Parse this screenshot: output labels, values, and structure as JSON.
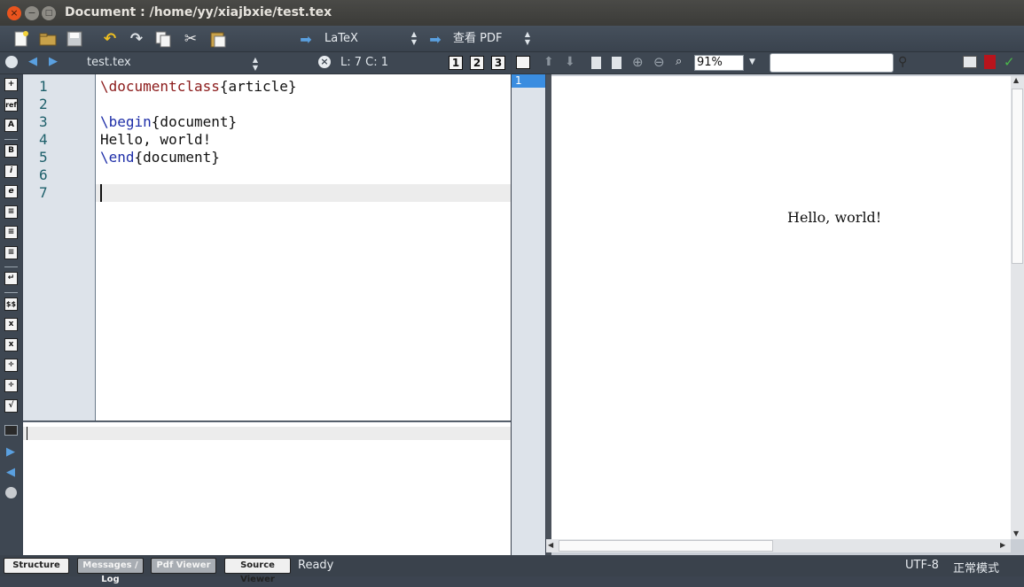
{
  "window": {
    "title": "Document : /home/yy/xiajbxie/test.tex",
    "controls": {
      "close": "×",
      "minimize": "−",
      "maximize": "□"
    }
  },
  "toolbar": {
    "icons": [
      "new-file-icon",
      "open-icon",
      "save-icon",
      "undo-icon",
      "redo-icon",
      "copy-icon",
      "cut-icon",
      "paste-icon"
    ],
    "build_combo": "LaTeX",
    "view_combo": "查看 PDF",
    "accent": "#5aa0e0"
  },
  "editor_header": {
    "file_name": "test.tex",
    "cursor_position": "L: 7 C: 1",
    "view_buttons": [
      "1",
      "2",
      "3"
    ]
  },
  "pdf_toolbar": {
    "zoom": "91%",
    "search_placeholder": ""
  },
  "sidebar_icons": [
    "+",
    "ref",
    "A",
    "B",
    "i",
    "e",
    "≡",
    "≡",
    "≡",
    "↵",
    "$$",
    "x",
    "x",
    "÷",
    "÷",
    "√"
  ],
  "editor": {
    "line_numbers": [
      "1",
      "2",
      "3",
      "4",
      "5",
      "6",
      "7"
    ],
    "lines": [
      {
        "cmd": "\\documentclass",
        "arg": "{article}",
        "style": "red"
      },
      {
        "cmd": "",
        "arg": "",
        "style": "plain"
      },
      {
        "cmd": "\\begin",
        "arg": "{document}",
        "style": "blue"
      },
      {
        "cmd": "",
        "arg": "Hello, world!",
        "style": "plain"
      },
      {
        "cmd": "\\end",
        "arg": "{document}",
        "style": "blue"
      },
      {
        "cmd": "",
        "arg": "",
        "style": "plain"
      },
      {
        "cmd": "",
        "arg": "",
        "style": "plain"
      }
    ]
  },
  "pdf": {
    "page_number": "1",
    "content": "Hello, world!"
  },
  "statusbar": {
    "buttons": [
      "Structure",
      "Messages / Log",
      "Pdf Viewer",
      "Source Viewer"
    ],
    "status": "Ready",
    "encoding": "UTF-8",
    "mode": "正常模式"
  }
}
